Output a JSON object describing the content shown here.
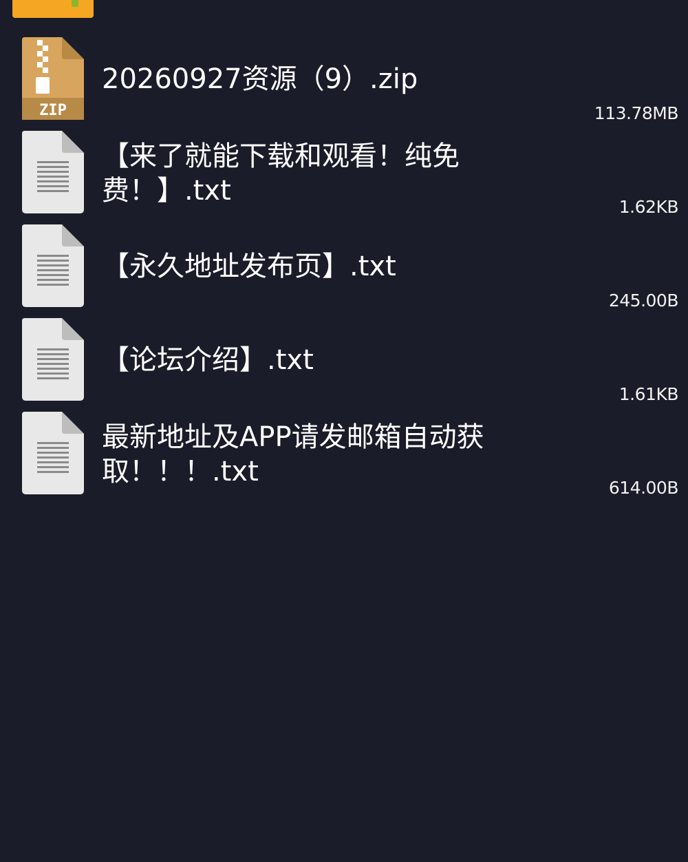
{
  "colors": {
    "background": "#1b1c29",
    "folder_icon": "#f5a623",
    "zip_icon": "#d7a55e",
    "txt_icon": "#e8e8e8"
  },
  "files": [
    {
      "name": "20260927资源（9）.zip",
      "size": "113.78MB",
      "type": "zip",
      "icon": "zip-file-icon",
      "icon_label": "ZIP"
    },
    {
      "name": "【来了就能下载和观看！纯免费！】.txt",
      "size": "1.62KB",
      "type": "txt",
      "icon": "text-file-icon"
    },
    {
      "name": "【永久地址发布页】.txt",
      "size": "245.00B",
      "type": "txt",
      "icon": "text-file-icon"
    },
    {
      "name": "【论坛介绍】.txt",
      "size": "1.61KB",
      "type": "txt",
      "icon": "text-file-icon"
    },
    {
      "name": "最新地址及APP请发邮箱自动获取！！！.txt",
      "size": "614.00B",
      "type": "txt",
      "icon": "text-file-icon"
    }
  ]
}
